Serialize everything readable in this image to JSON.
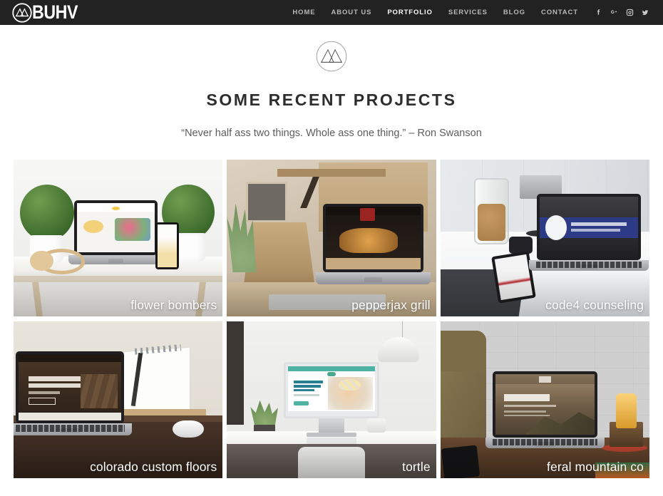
{
  "header": {
    "brand": {
      "text": "BUHV",
      "mark_icon": "mountain-circle-logo-icon"
    },
    "nav": [
      {
        "label": "HOME",
        "active": false
      },
      {
        "label": "ABOUT US",
        "active": false
      },
      {
        "label": "PORTFOLIO",
        "active": true
      },
      {
        "label": "SERVICES",
        "active": false
      },
      {
        "label": "BLOG",
        "active": false
      },
      {
        "label": "CONTACT",
        "active": false
      }
    ],
    "social": [
      {
        "name": "facebook-icon",
        "label": "Facebook"
      },
      {
        "name": "googleplus-icon",
        "label": "Google Plus"
      },
      {
        "name": "instagram-icon",
        "label": "Instagram"
      },
      {
        "name": "twitter-icon",
        "label": "Twitter"
      }
    ],
    "background_color": "#222222",
    "active_color": "#ffffff",
    "inactive_color": "#b8b8b8"
  },
  "intro": {
    "emblem_icon": "mountain-circle-emblem-icon",
    "title": "SOME RECENT PROJECTS",
    "quote": "“Never half ass two things. Whole ass one thing.” – Ron Swanson",
    "title_color": "#2d2d2d",
    "quote_color": "#5d5d5d"
  },
  "portfolio": {
    "projects": [
      {
        "label": "flower bombers",
        "alt": "Laptop and phone mockups on a light wooden table between two topiary plants with headphones"
      },
      {
        "label": "pepperjax grill",
        "alt": "Laptop showing a food website on a rustic wooden desk with a DO WHAT YOU LOVE poster"
      },
      {
        "label": "code4 counseling",
        "alt": "MacBook on a white desk with cookie jar, speaker, smartphone and watch"
      },
      {
        "label": "colorado custom floors",
        "alt": "Laptop on a dark wooden desk next to a spiral notebook, pencil and white mouse"
      },
      {
        "label": "tortle",
        "alt": "iMac on a white desk showing a baby health website, with pendant lamp, plant and mug"
      },
      {
        "label": "feral mountain co",
        "alt": "Laptop showing the FERAL site against a white brick wall with a backpack and Edison bulb lamp"
      }
    ],
    "columns": 3,
    "label_color": "#ffffff"
  }
}
